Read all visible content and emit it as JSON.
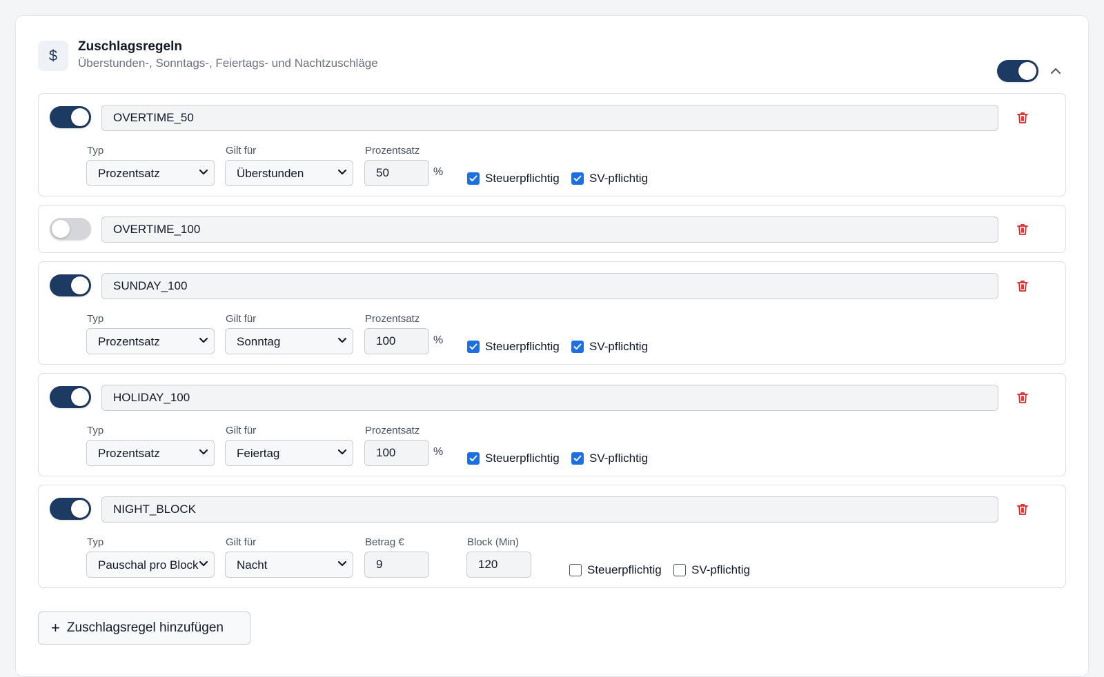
{
  "section": {
    "icon": "dollar-icon",
    "icon_glyph": "$",
    "title": "Zuschlagsregeln",
    "subtitle": "Überstunden-, Sonntags-, Feiertags- und Nachtzuschläge",
    "enabled": true
  },
  "labels": {
    "type": "Typ",
    "applies_to": "Gilt für",
    "percentage": "Prozentsatz",
    "amount": "Betrag €",
    "block": "Block (Min)",
    "percent_unit": "%",
    "taxable": "Steuerpflichtig",
    "sv": "SV-pflichtig"
  },
  "rules": [
    {
      "code": "OVERTIME_50",
      "enabled": true,
      "type": "Prozentsatz",
      "applies_to": "Überstunden",
      "value": "50",
      "taxable": true,
      "sv": true
    },
    {
      "code": "OVERTIME_100",
      "enabled": false
    },
    {
      "code": "SUNDAY_100",
      "enabled": true,
      "type": "Prozentsatz",
      "applies_to": "Sonntag",
      "value": "100",
      "taxable": true,
      "sv": true
    },
    {
      "code": "HOLIDAY_100",
      "enabled": true,
      "type": "Prozentsatz",
      "applies_to": "Feiertag",
      "value": "100",
      "taxable": true,
      "sv": true
    },
    {
      "code": "NIGHT_BLOCK",
      "enabled": true,
      "type": "Pauschal pro Block",
      "applies_to": "Nacht",
      "value": "9",
      "block": "120",
      "taxable": false,
      "sv": false
    }
  ],
  "add_button": {
    "label": "Zuschlagsregel hinzufügen",
    "icon": "plus-icon"
  },
  "colors": {
    "toggle_on": "#1d3a62",
    "toggle_off": "#d4d6da",
    "checkbox": "#1d6fe0",
    "danger": "#dc2626"
  }
}
